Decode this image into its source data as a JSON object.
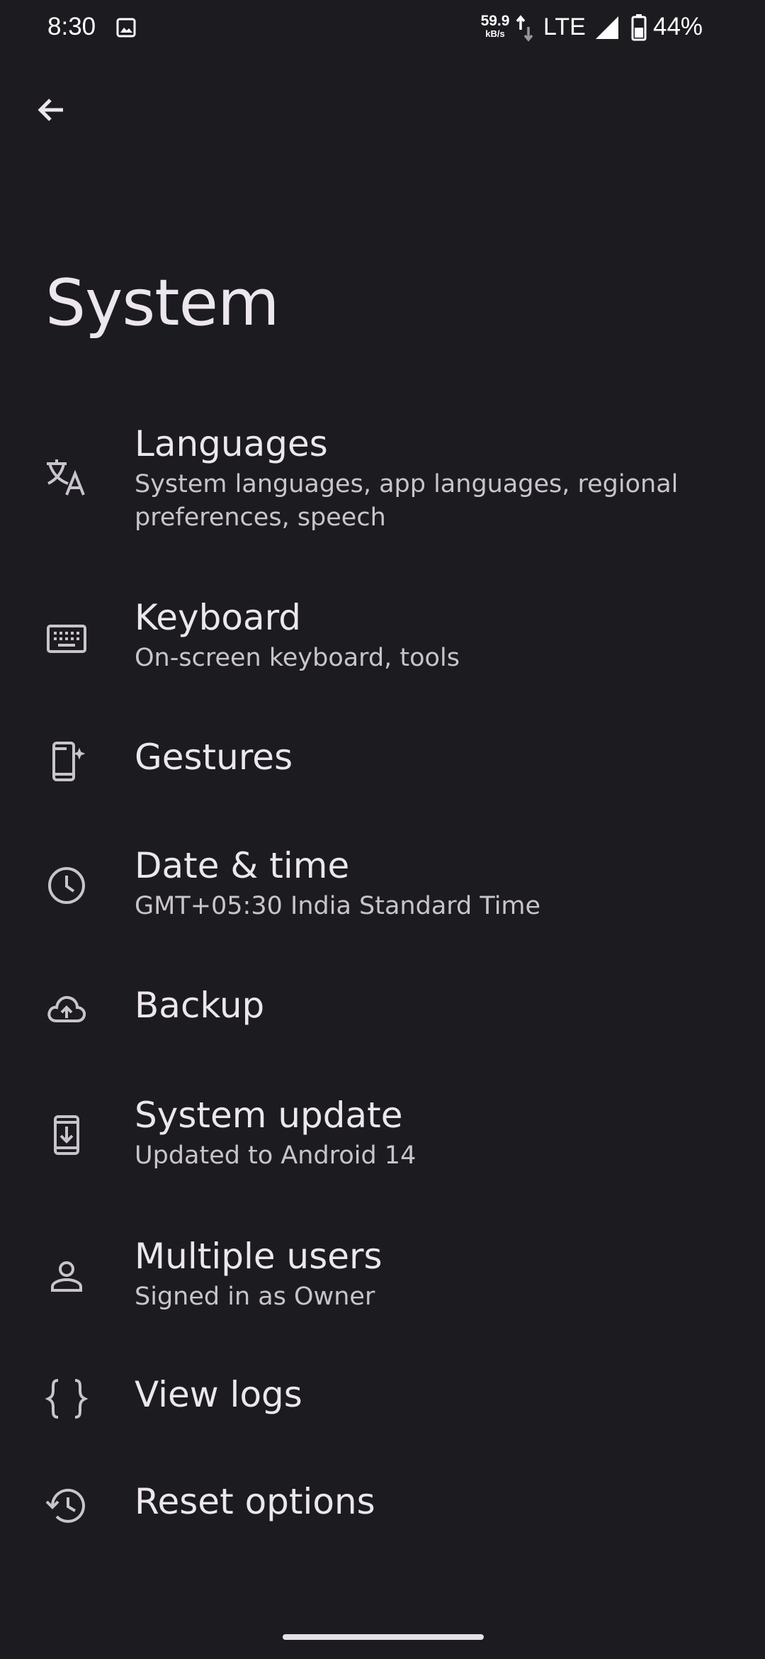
{
  "status_bar": {
    "time": "8:30",
    "net_speed_value": "59.9",
    "net_speed_unit": "kB/s",
    "network_type": "LTE",
    "battery_percent": "44%"
  },
  "page": {
    "title": "System"
  },
  "items": [
    {
      "title": "Languages",
      "summary": "System languages, app languages, regional preferences, speech",
      "icon": "translate-icon"
    },
    {
      "title": "Keyboard",
      "summary": "On-screen keyboard, tools",
      "icon": "keyboard-icon"
    },
    {
      "title": "Gestures",
      "summary": "",
      "icon": "gestures-phone-icon"
    },
    {
      "title": "Date & time",
      "summary": "GMT+05:30 India Standard Time",
      "icon": "clock-icon"
    },
    {
      "title": "Backup",
      "summary": "",
      "icon": "cloud-upload-icon"
    },
    {
      "title": "System update",
      "summary": "Updated to Android 14",
      "icon": "system-update-icon"
    },
    {
      "title": "Multiple users",
      "summary": "Signed in as Owner",
      "icon": "person-icon"
    },
    {
      "title": "View logs",
      "summary": "",
      "icon": "braces-icon"
    },
    {
      "title": "Reset options",
      "summary": "",
      "icon": "history-icon"
    }
  ]
}
